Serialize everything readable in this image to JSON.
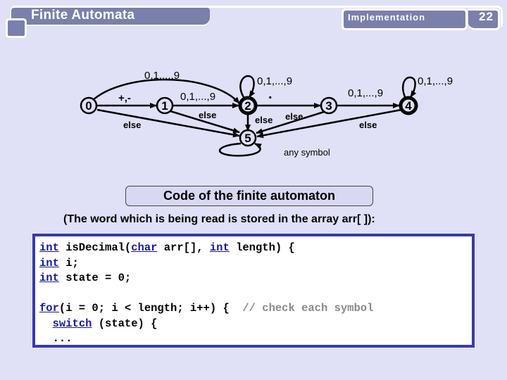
{
  "header": {
    "title": "Finite Automata",
    "section": "Implementation",
    "page_number": "22"
  },
  "diagram": {
    "states": [
      {
        "id": "0",
        "label": "0",
        "type": "start"
      },
      {
        "id": "1",
        "label": "1",
        "type": "normal"
      },
      {
        "id": "2",
        "label": "2",
        "type": "accepting"
      },
      {
        "id": "3",
        "label": "3",
        "type": "normal"
      },
      {
        "id": "4",
        "label": "4",
        "type": "accepting"
      },
      {
        "id": "5",
        "label": "5",
        "type": "error"
      }
    ],
    "transitions": [
      {
        "from": "0",
        "to": "2",
        "label": "0,1,...,9"
      },
      {
        "from": "0",
        "to": "1",
        "label": "+,-"
      },
      {
        "from": "0",
        "to": "5",
        "label": "else"
      },
      {
        "from": "1",
        "to": "2",
        "label": "0,1,...,9"
      },
      {
        "from": "1",
        "to": "5",
        "label": "else"
      },
      {
        "from": "2",
        "to": "2",
        "label": "0,1,...,9"
      },
      {
        "from": "2",
        "to": "3",
        "label": "."
      },
      {
        "from": "2",
        "to": "5",
        "label": "else"
      },
      {
        "from": "3",
        "to": "4",
        "label": "0,1,...,9"
      },
      {
        "from": "3",
        "to": "5",
        "label": "else"
      },
      {
        "from": "4",
        "to": "4",
        "label": "0,1,...,9"
      },
      {
        "from": "4",
        "to": "5",
        "label": "else"
      },
      {
        "from": "5",
        "to": "5",
        "label": "any symbol"
      }
    ]
  },
  "code_section": {
    "title": "Code of the finite automaton",
    "note": "(The word which is being read is stored in the array arr[ ]):",
    "lines": [
      [
        {
          "t": "int",
          "k": "kw"
        },
        {
          "t": " isDecimal(",
          "k": ""
        },
        {
          "t": "char",
          "k": "kw"
        },
        {
          "t": " arr[], ",
          "k": ""
        },
        {
          "t": "int",
          "k": "kw"
        },
        {
          "t": " length) {",
          "k": ""
        }
      ],
      [
        {
          "t": "int",
          "k": "kw"
        },
        {
          "t": " i;",
          "k": ""
        }
      ],
      [
        {
          "t": "int",
          "k": "kw"
        },
        {
          "t": " state = 0;",
          "k": ""
        }
      ],
      [],
      [
        {
          "t": "for",
          "k": "kw"
        },
        {
          "t": "(i = 0; i < length; i++) {  ",
          "k": ""
        },
        {
          "t": "// check each symbol",
          "k": "cmt"
        }
      ],
      [
        {
          "t": "  ",
          "k": ""
        },
        {
          "t": "switch",
          "k": "kw"
        },
        {
          "t": " (state) {",
          "k": ""
        }
      ],
      [
        {
          "t": "  ...",
          "k": ""
        }
      ]
    ]
  }
}
